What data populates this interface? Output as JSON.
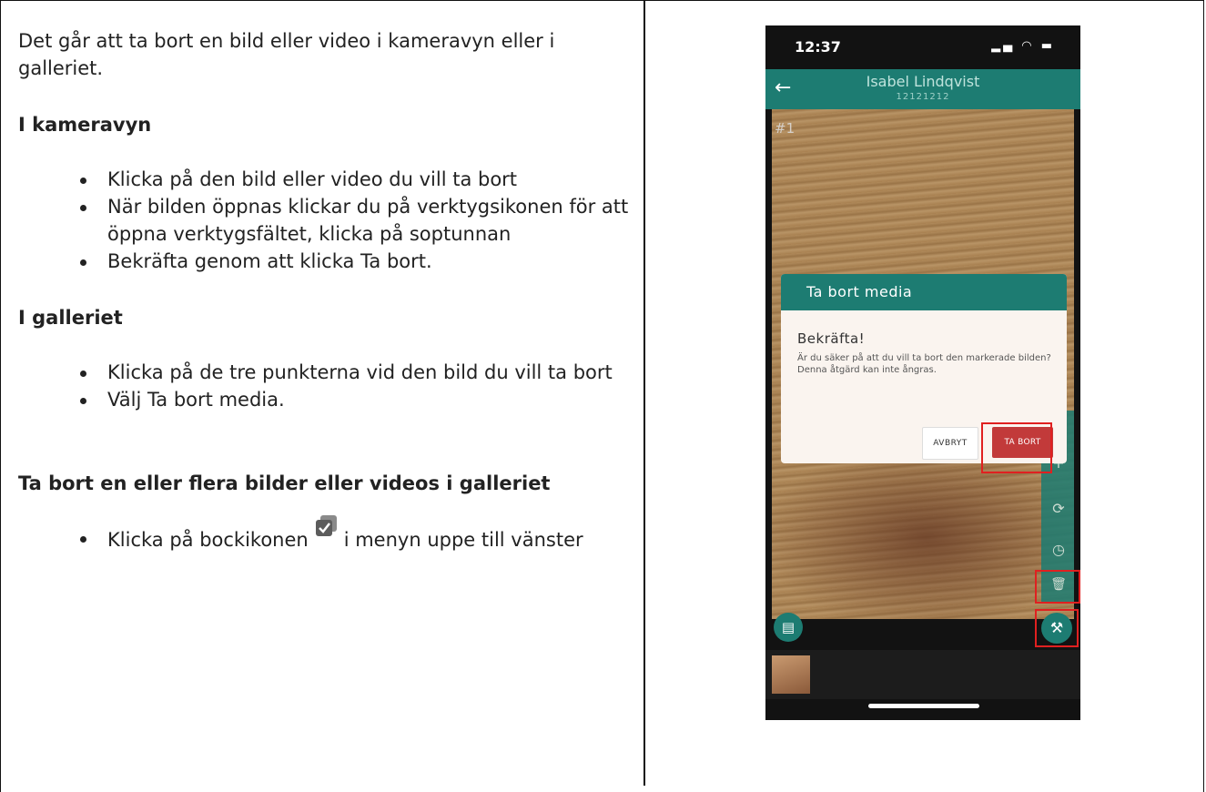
{
  "left": {
    "intro": "Det går att ta bort en bild eller video i kameravyn eller i galleriet.",
    "section1": {
      "heading": "I kameravyn",
      "items": [
        "Klicka på den bild eller video du vill ta bort",
        "När bilden öppnas klickar du på verktygsikonen för att öppna verktygsfältet, klicka på soptunnan",
        "Bekräfta genom att klicka Ta bort."
      ]
    },
    "section2": {
      "heading": "I galleriet",
      "items": [
        "Klicka på de tre punkterna vid den bild du vill ta bort",
        "Välj Ta bort media."
      ]
    },
    "section3": {
      "heading": "Ta bort en eller flera bilder eller videos i galleriet",
      "item_before": "Klicka på bockikonen",
      "item_after": "i menyn uppe till vänster"
    }
  },
  "phone": {
    "time": "12:37",
    "status_icons": "▂▄ ◠ ▬",
    "patient_name": "Isabel Lindqvist",
    "patient_id": "12121212",
    "photo_number": "#1",
    "dialog": {
      "header": "Ta bort media",
      "title": "Bekräfta!",
      "message": "Är du säker på att du vill ta bort den markerade bilden? Denna åtgärd kan inte ångras.",
      "cancel_label": "AVBRYT",
      "delete_label": "TA BORT"
    },
    "icons": {
      "back": "←",
      "add": "+",
      "rotate": "⟳",
      "history": "◷",
      "trash": "🗑",
      "tools": "⚒",
      "chat": "▤"
    },
    "colors": {
      "accent": "#1d7c72",
      "danger": "#c23a3a",
      "highlight": "#e02020"
    }
  }
}
